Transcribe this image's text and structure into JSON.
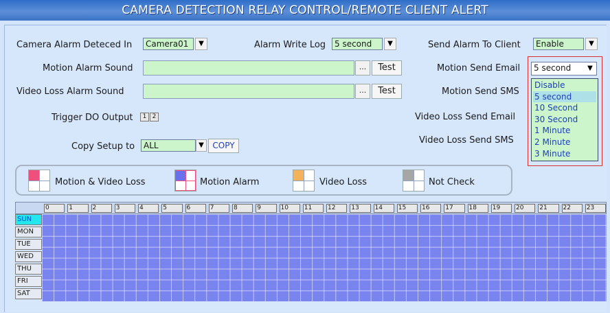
{
  "title": "CAMERA DETECTION RELAY CONTROL/REMOTE CLIENT ALERT",
  "camera_alarm": {
    "label": "Camera Alarm Deteced In",
    "value": "Camera01"
  },
  "alarm_write_log": {
    "label": "Alarm Write Log",
    "value": "5 second"
  },
  "send_alarm_client": {
    "label": "Send Alarm To Client",
    "value": "Enable"
  },
  "motion_sound": {
    "label": "Motion Alarm Sound",
    "value": "",
    "browse": "...",
    "test": "Test"
  },
  "video_loss_sound": {
    "label": "Video Loss Alarm Sound",
    "value": "",
    "browse": "...",
    "test": "Test"
  },
  "trigger_do": {
    "label": "Trigger DO Output",
    "outputs": [
      "1",
      "2"
    ]
  },
  "copy_setup": {
    "label": "Copy Setup to",
    "value": "ALL",
    "button": "COPY"
  },
  "motion_send_email": {
    "label": "Motion Send Email",
    "value": "5 second"
  },
  "motion_send_sms": {
    "label": "Motion Send SMS"
  },
  "video_loss_send_email": {
    "label": "Video Loss Send Email"
  },
  "video_loss_send_sms": {
    "label": "Video Loss Send SMS"
  },
  "dropdown_options": [
    "Disable",
    "5 second",
    "10 Second",
    "30 Second",
    "1 Minute",
    "2 Minute",
    "3 Minute"
  ],
  "dropdown_highlighted": "5 second",
  "legend": [
    {
      "label": "Motion & Video Loss",
      "color": "#ee4f7c"
    },
    {
      "label": "Motion Alarm",
      "color": "#6a6ff0"
    },
    {
      "label": "Video Loss",
      "color": "#f4b25a"
    },
    {
      "label": "Not Check",
      "color": "#a6a6a6"
    }
  ],
  "schedule": {
    "hours": [
      "0",
      "1",
      "2",
      "3",
      "4",
      "5",
      "6",
      "7",
      "8",
      "9",
      "10",
      "11",
      "12",
      "13",
      "14",
      "15",
      "16",
      "17",
      "18",
      "19",
      "20",
      "21",
      "22",
      "23"
    ],
    "days": [
      "SUN",
      "MON",
      "TUE",
      "WED",
      "THU",
      "FRI",
      "SAT"
    ],
    "selected_day": "SUN",
    "cell_color": "#7a84ee"
  },
  "icons": {
    "dropdown_arrow": "chevron-down-icon"
  }
}
